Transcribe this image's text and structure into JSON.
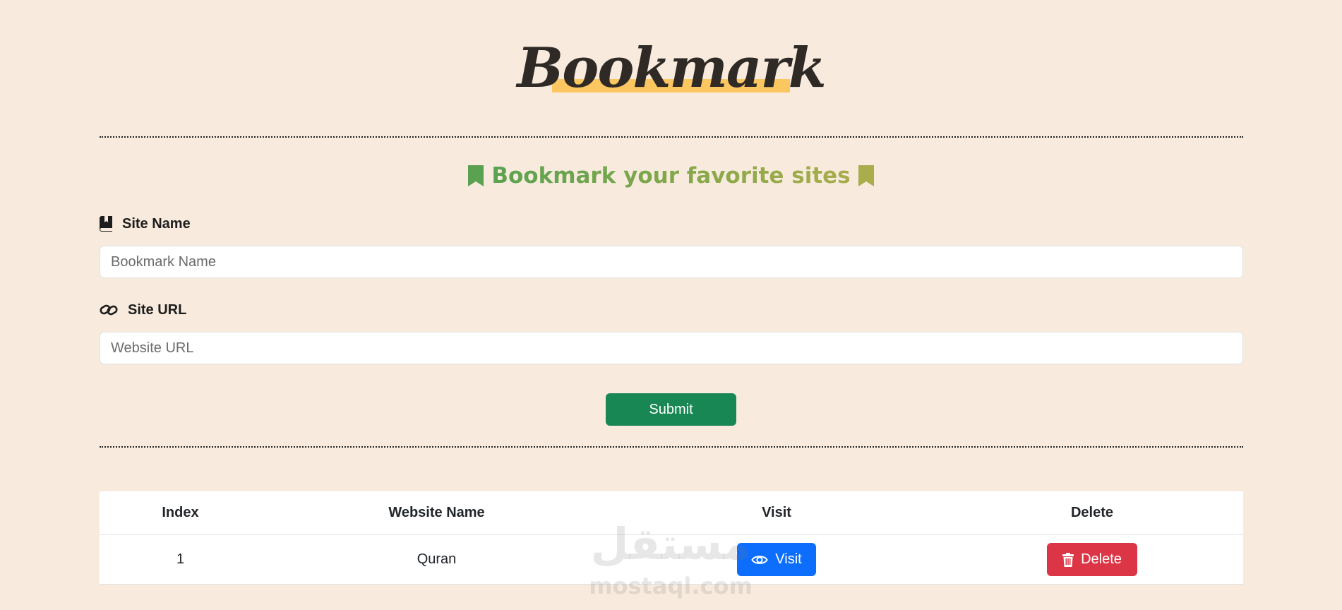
{
  "header": {
    "logo_text": "Bookmark",
    "subtitle": "Bookmark your favorite sites",
    "colors": {
      "logo_highlight": "#fcc661",
      "subtitle_start": "#5aa251",
      "subtitle_end": "#a9ad4c"
    }
  },
  "form": {
    "site_name": {
      "label": "Site Name",
      "icon": "book-bookmark-icon",
      "placeholder": "Bookmark Name",
      "value": ""
    },
    "site_url": {
      "label": "Site URL",
      "icon": "link-icon",
      "placeholder": "Website URL",
      "value": ""
    },
    "submit_label": "Submit"
  },
  "table": {
    "headers": [
      "Index",
      "Website Name",
      "Visit",
      "Delete"
    ],
    "rows": [
      {
        "index": "1",
        "name": "Quran",
        "visit_label": "Visit",
        "delete_label": "Delete"
      }
    ]
  },
  "watermark": {
    "arabic": "مستقل",
    "latin": "mostaql.com"
  },
  "colors": {
    "background": "#f8ebde",
    "submit": "#198754",
    "visit": "#0d6efd",
    "delete": "#dc3545"
  }
}
